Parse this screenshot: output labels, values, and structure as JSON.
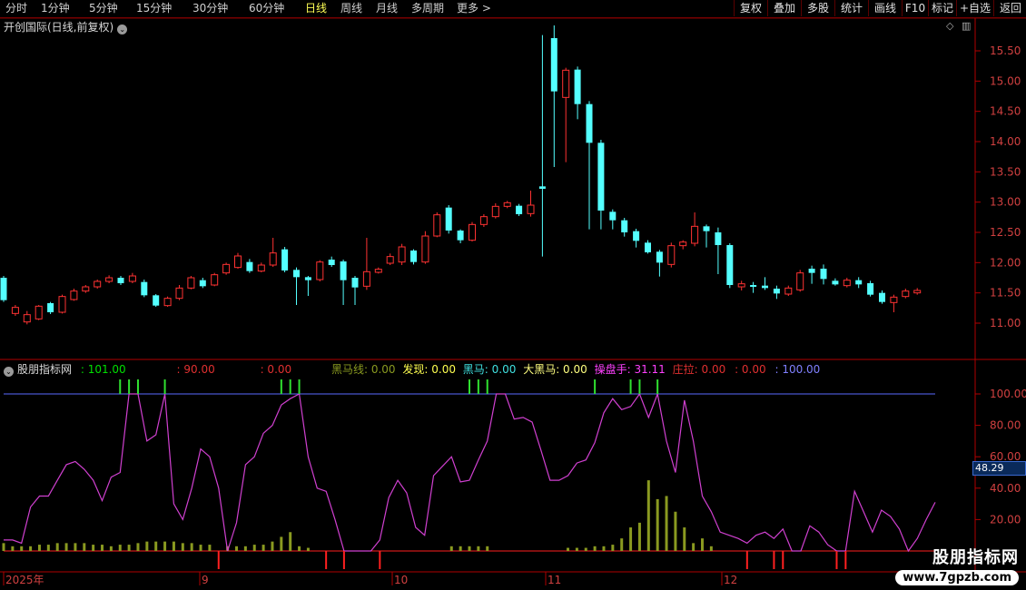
{
  "toolbar": {
    "periods": [
      "分时",
      "1分钟",
      "5分钟",
      "15分钟",
      "30分钟",
      "60分钟",
      "日线",
      "周线",
      "月线",
      "多周期",
      "更多 >"
    ],
    "active_index": 6,
    "right_buttons": [
      "复权",
      "叠加",
      "多股",
      "统计",
      "画线",
      "F10",
      "标记",
      "+自选",
      "返回"
    ]
  },
  "stock": {
    "title": "开创国际(日线,前复权)"
  },
  "price_axis": [
    "15.50",
    "15.00",
    "14.50",
    "14.00",
    "13.50",
    "13.00",
    "12.50",
    "12.00",
    "11.50",
    "11.00"
  ],
  "indicator": {
    "name": "股朋指标网",
    "items": [
      {
        "text": ": 101.00",
        "color": "#00e000"
      },
      {
        "text": ": 90.00",
        "color": "#e03030"
      },
      {
        "text": ": 0.00",
        "color": "#e03030"
      },
      {
        "text": "黑马线: 0.00",
        "color": "#8a9a20"
      },
      {
        "text": "发现: 0.00",
        "color": "#ffff50"
      },
      {
        "text": "黑马: 0.00",
        "color": "#40e0e0"
      },
      {
        "text": "大黑马: 0.00",
        "color": "#ffff80"
      },
      {
        "text": "操盘手: 31.11",
        "color": "#ff40ff"
      },
      {
        "text": "庄拉: 0.00",
        "color": "#e03030"
      },
      {
        "text": ": 0.00",
        "color": "#e03030"
      },
      {
        "text": ": 100.00",
        "color": "#8080ff"
      }
    ],
    "axis": [
      "100.00",
      "80.00",
      "60.00",
      "40.00",
      "20.00"
    ],
    "current_tag": "48.29"
  },
  "time_axis": [
    "2025年",
    "9",
    "10",
    "11",
    "12"
  ],
  "watermark": {
    "line1": "股朋指标网",
    "line2": "www.7gpzb.com"
  },
  "colors": {
    "up": "#ff3232",
    "down": "#54ffff",
    "osc": "#d040d0",
    "ref": "#5a6aff",
    "signal": "#30e030",
    "bars": "#8a9a20",
    "neg": "#ff2020"
  },
  "chart_data": {
    "type": "candlestick",
    "title": "开创国际(日线,前复权)",
    "ylim": [
      10.6,
      15.9
    ],
    "candles": [
      [
        11.75,
        11.38,
        11.78,
        11.35,
        0
      ],
      [
        11.26,
        11.16,
        11.3,
        11.12,
        1
      ],
      [
        11.14,
        11.02,
        11.2,
        10.98,
        1
      ],
      [
        11.07,
        11.28,
        11.3,
        11.05,
        1
      ],
      [
        11.33,
        11.18,
        11.35,
        11.15,
        0
      ],
      [
        11.18,
        11.44,
        11.47,
        11.16,
        1
      ],
      [
        11.39,
        11.53,
        11.57,
        11.37,
        1
      ],
      [
        11.53,
        11.6,
        11.63,
        11.5,
        1
      ],
      [
        11.6,
        11.69,
        11.72,
        11.57,
        1
      ],
      [
        11.69,
        11.75,
        11.79,
        11.66,
        1
      ],
      [
        11.75,
        11.66,
        11.78,
        11.63,
        0
      ],
      [
        11.69,
        11.78,
        11.83,
        11.66,
        1
      ],
      [
        11.68,
        11.46,
        11.72,
        11.43,
        0
      ],
      [
        11.46,
        11.29,
        11.48,
        11.27,
        0
      ],
      [
        11.29,
        11.41,
        11.44,
        11.27,
        1
      ],
      [
        11.41,
        11.58,
        11.63,
        11.38,
        1
      ],
      [
        11.58,
        11.75,
        11.78,
        11.56,
        1
      ],
      [
        11.71,
        11.61,
        11.75,
        11.58,
        0
      ],
      [
        11.63,
        11.8,
        11.83,
        11.61,
        1
      ],
      [
        11.83,
        11.97,
        12.0,
        11.8,
        1
      ],
      [
        11.92,
        12.11,
        12.16,
        11.9,
        1
      ],
      [
        12.01,
        11.86,
        12.06,
        11.83,
        0
      ],
      [
        11.86,
        11.96,
        12.0,
        11.84,
        1
      ],
      [
        11.96,
        12.16,
        12.41,
        11.93,
        1
      ],
      [
        12.22,
        11.87,
        12.26,
        11.84,
        0
      ],
      [
        11.88,
        11.76,
        11.92,
        11.3,
        0
      ],
      [
        11.76,
        11.71,
        11.78,
        11.45,
        0
      ],
      [
        11.72,
        12.01,
        12.04,
        11.69,
        1
      ],
      [
        12.05,
        11.96,
        12.1,
        11.93,
        0
      ],
      [
        12.02,
        11.71,
        12.05,
        11.3,
        0
      ],
      [
        11.75,
        11.59,
        11.78,
        11.3,
        0
      ],
      [
        11.61,
        11.85,
        12.41,
        11.55,
        1
      ],
      [
        11.84,
        11.89,
        11.92,
        11.82,
        1
      ],
      [
        11.99,
        12.1,
        12.15,
        11.96,
        1
      ],
      [
        12.01,
        12.26,
        12.31,
        11.96,
        1
      ],
      [
        12.2,
        12.01,
        12.22,
        11.97,
        0
      ],
      [
        12.01,
        12.44,
        12.52,
        11.98,
        1
      ],
      [
        12.44,
        12.79,
        12.83,
        12.42,
        1
      ],
      [
        12.91,
        12.53,
        12.95,
        12.48,
        0
      ],
      [
        12.53,
        12.37,
        12.55,
        12.32,
        0
      ],
      [
        12.37,
        12.63,
        12.67,
        12.35,
        1
      ],
      [
        12.63,
        12.76,
        12.8,
        12.59,
        1
      ],
      [
        12.76,
        12.93,
        12.98,
        12.73,
        1
      ],
      [
        12.93,
        12.99,
        13.02,
        12.9,
        1
      ],
      [
        12.94,
        12.8,
        12.97,
        12.77,
        0
      ],
      [
        12.81,
        12.95,
        13.19,
        12.76,
        1
      ],
      [
        13.26,
        13.22,
        15.76,
        12.1,
        0
      ],
      [
        15.71,
        14.83,
        15.92,
        13.58,
        0
      ],
      [
        14.73,
        15.18,
        15.22,
        13.66,
        1
      ],
      [
        15.19,
        14.62,
        15.24,
        14.37,
        0
      ],
      [
        14.62,
        13.98,
        14.67,
        12.55,
        0
      ],
      [
        13.98,
        12.86,
        14.03,
        12.55,
        0
      ],
      [
        12.84,
        12.7,
        12.88,
        12.55,
        0
      ],
      [
        12.7,
        12.5,
        12.74,
        12.43,
        0
      ],
      [
        12.52,
        12.36,
        12.56,
        12.25,
        0
      ],
      [
        12.33,
        12.17,
        12.37,
        12.15,
        0
      ],
      [
        12.18,
        12.0,
        12.21,
        11.77,
        0
      ],
      [
        11.97,
        12.28,
        12.33,
        11.92,
        1
      ],
      [
        12.28,
        12.34,
        12.37,
        12.22,
        1
      ],
      [
        12.32,
        12.6,
        12.83,
        12.27,
        1
      ],
      [
        12.6,
        12.52,
        12.63,
        12.25,
        0
      ],
      [
        12.5,
        12.29,
        12.58,
        11.81,
        0
      ],
      [
        12.29,
        11.63,
        12.32,
        11.58,
        0
      ],
      [
        11.6,
        11.65,
        11.7,
        11.54,
        1
      ],
      [
        11.63,
        11.6,
        11.68,
        11.5,
        0
      ],
      [
        11.62,
        11.58,
        11.76,
        11.55,
        0
      ],
      [
        11.57,
        11.49,
        11.62,
        11.4,
        0
      ],
      [
        11.48,
        11.58,
        11.62,
        11.45,
        1
      ],
      [
        11.55,
        11.83,
        11.88,
        11.52,
        1
      ],
      [
        11.83,
        11.9,
        11.95,
        11.65,
        0
      ],
      [
        11.9,
        11.73,
        11.97,
        11.64,
        0
      ],
      [
        11.7,
        11.64,
        11.74,
        11.62,
        0
      ],
      [
        11.62,
        11.71,
        11.75,
        11.59,
        1
      ],
      [
        11.71,
        11.64,
        11.76,
        11.58,
        0
      ],
      [
        11.66,
        11.47,
        11.7,
        11.44,
        0
      ],
      [
        11.5,
        11.35,
        11.54,
        11.32,
        0
      ],
      [
        11.34,
        11.43,
        11.47,
        11.18,
        1
      ],
      [
        11.44,
        11.53,
        11.57,
        11.41,
        1
      ],
      [
        11.5,
        11.54,
        11.58,
        11.47,
        1
      ]
    ],
    "osc": [
      7,
      7,
      5,
      28,
      35,
      35,
      45,
      55,
      57,
      52,
      45,
      32,
      47,
      50,
      100,
      100,
      70,
      74,
      100,
      30,
      20,
      40,
      65,
      60,
      40,
      0,
      18,
      55,
      60,
      75,
      80,
      93,
      97,
      100,
      60,
      40,
      38,
      20,
      0,
      0,
      0,
      0,
      7,
      34,
      45,
      37,
      15,
      10,
      48,
      54,
      60,
      44,
      45,
      58,
      70,
      100,
      100,
      84,
      85,
      82,
      64,
      45,
      45,
      48,
      56,
      58,
      69,
      88,
      97,
      90,
      92,
      100,
      85,
      100,
      70,
      50,
      96,
      70,
      35,
      25,
      12,
      10,
      8,
      5,
      10,
      12,
      8,
      14,
      0,
      0,
      16,
      12,
      4,
      0,
      0,
      38,
      25,
      12,
      26,
      22,
      14,
      0,
      8,
      20,
      31
    ],
    "bars": [
      5,
      3,
      3,
      3,
      4,
      4,
      5,
      5,
      5,
      5,
      4,
      4,
      3,
      4,
      4,
      5,
      6,
      6,
      6,
      6,
      5,
      5,
      4,
      4,
      0,
      3,
      3,
      3,
      4,
      4,
      6,
      9,
      12,
      3,
      2,
      0,
      0,
      0,
      0,
      0,
      0,
      0,
      0,
      0,
      0,
      0,
      0,
      0,
      0,
      0,
      3,
      3,
      3,
      3,
      3,
      0,
      0,
      0,
      0,
      0,
      0,
      0,
      0,
      2,
      2,
      2,
      3,
      3,
      4,
      8,
      15,
      18,
      45,
      33,
      35,
      25,
      15,
      5,
      8,
      3,
      0,
      0,
      0,
      0,
      0,
      0,
      0,
      0,
      0,
      0,
      0,
      0,
      0,
      0,
      0,
      0,
      0,
      0,
      0,
      0,
      0,
      0,
      0,
      0,
      0
    ],
    "signals": [
      13,
      14,
      15,
      18,
      31,
      32,
      33,
      52,
      53,
      54,
      66,
      70,
      71,
      73
    ],
    "neg_marks": [
      24,
      36,
      38,
      42,
      83,
      86,
      87,
      93,
      94
    ]
  }
}
